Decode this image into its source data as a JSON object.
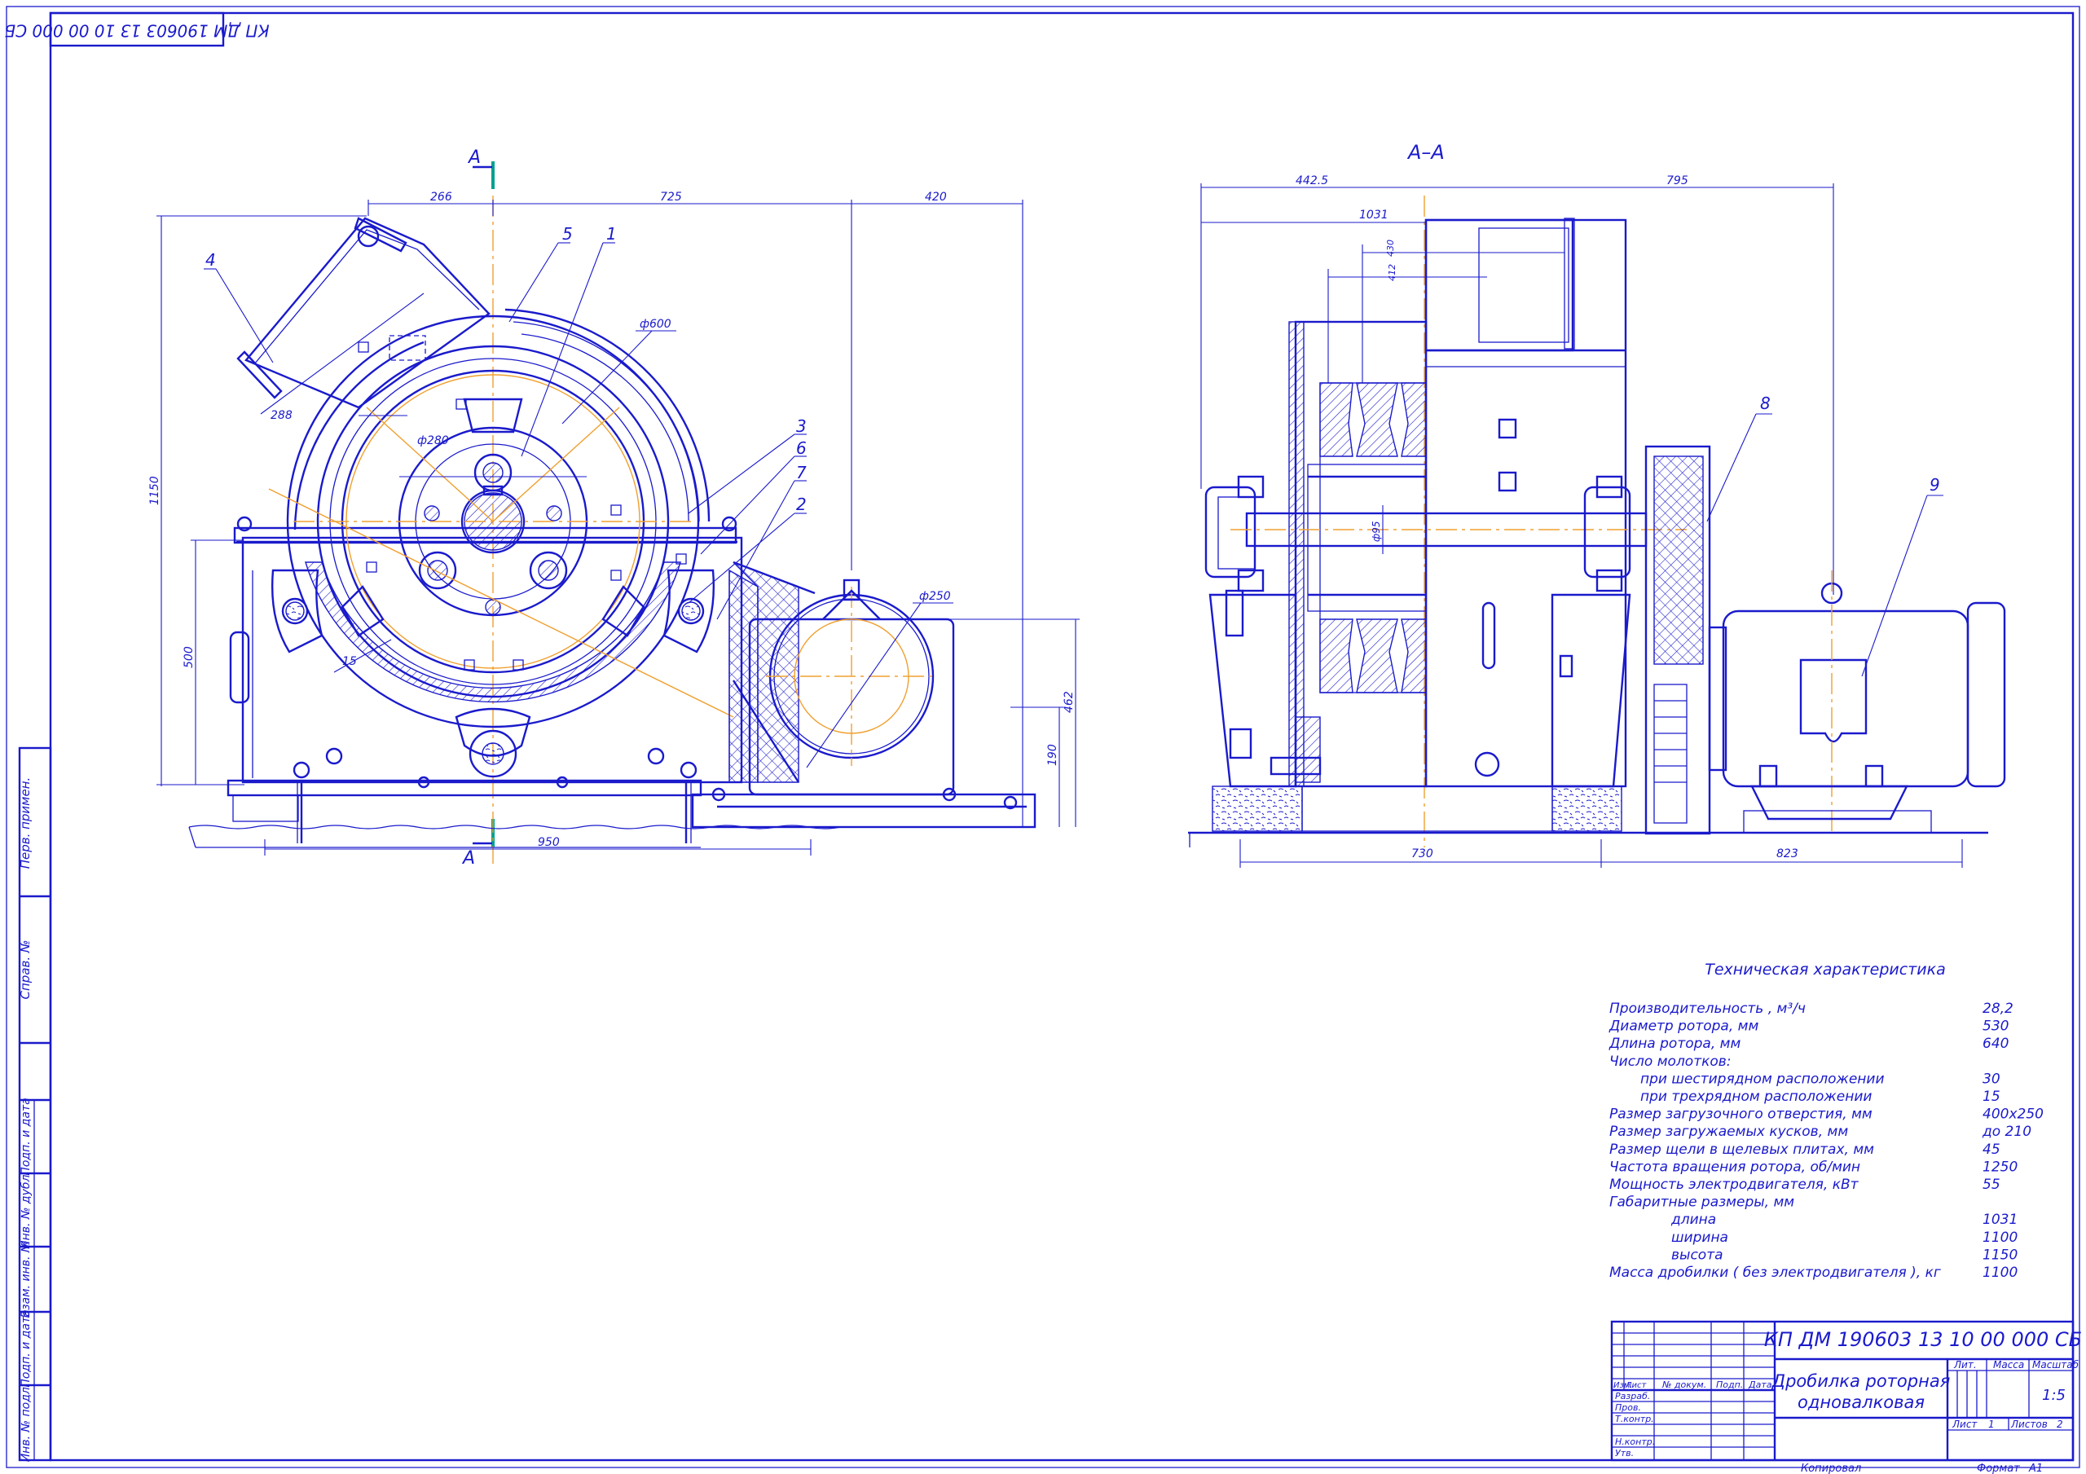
{
  "stamp": {
    "code": "КП ДМ 190603 13 10 00 000 СБ"
  },
  "section_marks": {
    "left": "А",
    "right": "А",
    "view_title": "А–А"
  },
  "front_view": {
    "dims": {
      "top_left": "266",
      "top_mid": "725",
      "top_right": "420",
      "overall_height": "1150",
      "base_height": "500",
      "bottom_width": "950",
      "right_height": "462",
      "motor_height": "190",
      "rotor_dia": "ф600",
      "inner_dia": "ф280",
      "pulley_dia": "ф250",
      "hopper_width": "288",
      "gap": "15"
    },
    "callouts": [
      "1",
      "2",
      "3",
      "4",
      "5",
      "6",
      "7"
    ]
  },
  "section_view": {
    "dims": {
      "top_left": "442.5",
      "top_right": "795",
      "width_1031": "1031",
      "d430": "430",
      "d412": "412",
      "shaft": "ф95",
      "bottom_left": "730",
      "bottom_right": "823"
    },
    "callouts": [
      "8",
      "9"
    ]
  },
  "spec": {
    "title": "Техническая характеристика",
    "rows": [
      {
        "label": "Производительность , м³/ч",
        "value": "28,2",
        "indent": 0
      },
      {
        "label": "Диаметр ротора, мм",
        "value": "530",
        "indent": 0
      },
      {
        "label": "Длина ротора, мм",
        "value": "640",
        "indent": 0
      },
      {
        "label": "Число молотков:",
        "value": "",
        "indent": 0
      },
      {
        "label": "при шестирядном расположении",
        "value": "30",
        "indent": 1
      },
      {
        "label": "при трехрядном расположении",
        "value": "15",
        "indent": 1
      },
      {
        "label": "Размер загрузочного отверстия, мм",
        "value": "400х250",
        "indent": 0
      },
      {
        "label": "Размер загружаемых кусков, мм",
        "value": "до 210",
        "indent": 0
      },
      {
        "label": "Размер щели в щелевых плитах, мм",
        "value": "45",
        "indent": 0
      },
      {
        "label": "Частота вращения ротора, об/мин",
        "value": "1250",
        "indent": 0
      },
      {
        "label": "Мощность электродвигателя, кВт",
        "value": "55",
        "indent": 0
      },
      {
        "label": "Габаритные размеры, мм",
        "value": "",
        "indent": 0
      },
      {
        "label": "длина",
        "value": "1031",
        "indent": 2
      },
      {
        "label": "ширина",
        "value": "1100",
        "indent": 2
      },
      {
        "label": "высота",
        "value": "1150",
        "indent": 2
      },
      {
        "label": "Масса дробилки ( без электродвигателя ), кг",
        "value": "1100",
        "indent": 0
      }
    ]
  },
  "left_strip": [
    "Перв. примен.",
    "Справ. №",
    "Подп. и дата",
    "Инв. № дубл.",
    "Взам. инв. №",
    "Подп. и дата",
    "Инв. № подл."
  ],
  "title_block": {
    "doc_code": "КП ДМ 190603 13 10 00 000 СБ",
    "name_line1": "Дробилка роторная",
    "name_line2": "одновалковая",
    "col_headers": [
      "Изм.",
      "Лист",
      "№ докум.",
      "Подп.",
      "Дата"
    ],
    "roles": [
      "Разраб.",
      "Пров.",
      "Т.контр.",
      "Н.контр.",
      "Утв."
    ],
    "lit_label": "Лит.",
    "mass_label": "Масса",
    "scale_label": "Масштаб",
    "scale_value": "1:5",
    "sheet_label": "Лист",
    "sheet_value": "1",
    "sheets_label": "Листов",
    "sheets_value": "2",
    "copied": "Копировал",
    "format_label": "Формат",
    "format_value": "А1"
  }
}
